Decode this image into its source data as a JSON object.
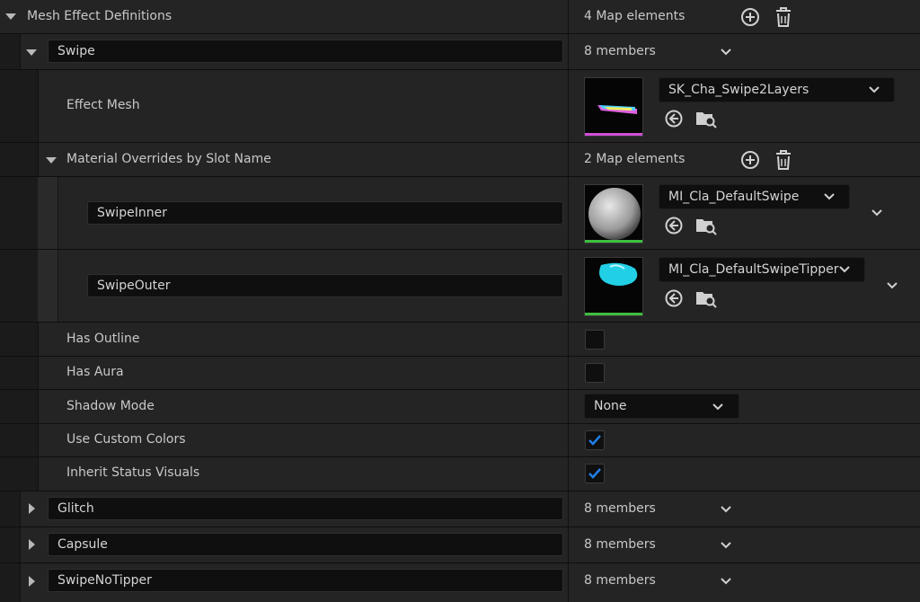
{
  "root": {
    "label": "Mesh Effect Definitions",
    "count": "4 Map elements"
  },
  "entries": [
    {
      "key": "Swipe",
      "members": "8 members",
      "expanded": true,
      "properties": {
        "effect_mesh": {
          "label": "Effect Mesh",
          "asset": "SK_Cha_Swipe2Layers"
        },
        "material_overrides": {
          "label": "Material Overrides by Slot Name",
          "count": "2 Map elements",
          "slots": [
            {
              "key": "SwipeInner",
              "asset": "MI_Cla_DefaultSwipe"
            },
            {
              "key": "SwipeOuter",
              "asset": "MI_Cla_DefaultSwipeTipper"
            }
          ]
        },
        "has_outline": {
          "label": "Has Outline",
          "checked": false
        },
        "has_aura": {
          "label": "Has Aura",
          "checked": false
        },
        "shadow_mode": {
          "label": "Shadow Mode",
          "value": "None"
        },
        "use_custom_colors": {
          "label": "Use Custom Colors",
          "checked": true
        },
        "inherit_status_visuals": {
          "label": "Inherit Status Visuals",
          "checked": true
        }
      }
    },
    {
      "key": "Glitch",
      "members": "8 members",
      "expanded": false
    },
    {
      "key": "Capsule",
      "members": "8 members",
      "expanded": false
    },
    {
      "key": "SwipeNoTipper",
      "members": "8 members",
      "expanded": false
    }
  ],
  "icons": {
    "add": "plus-circle-icon",
    "delete": "trash-icon",
    "use_selected": "arrow-left-circle-icon",
    "browse": "folder-search-icon",
    "expand": "chevron-down-icon",
    "checkmark": "checkmark-icon"
  },
  "colors": {
    "accent_check": "#1f7fe8",
    "mesh_bar": "#d04fd8",
    "material_bar": "#3fbf3f",
    "tipper_cyan": "#22d0e6"
  }
}
